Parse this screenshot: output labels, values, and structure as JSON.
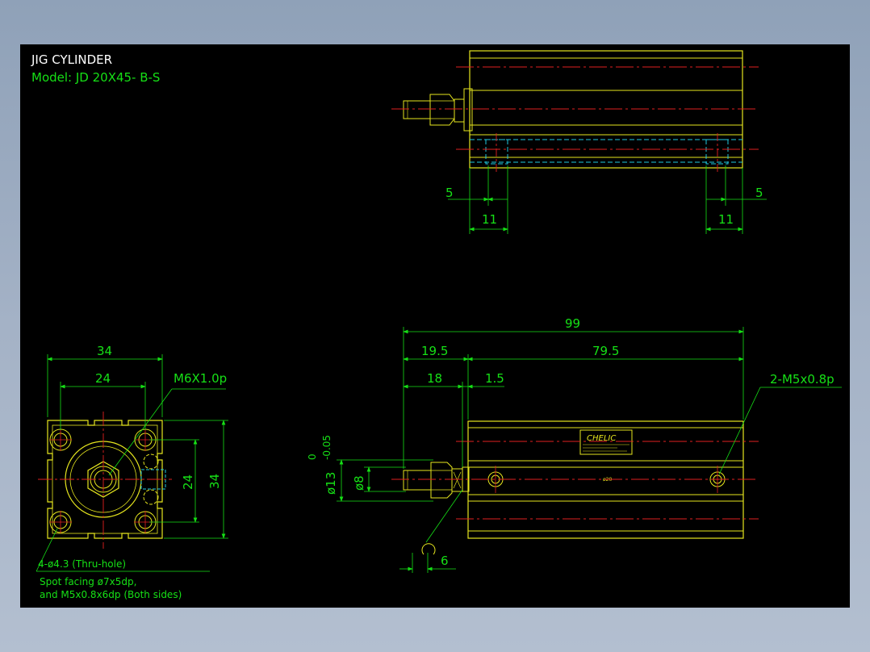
{
  "title": {
    "line1": "JIG CYLINDER",
    "line2": "Model:  JD 20X45- B-S"
  },
  "top_view": {
    "dim_left_5": "5",
    "dim_left_11": "11",
    "dim_right_5": "5",
    "dim_right_11": "11"
  },
  "front_view": {
    "dim_34_width": "34",
    "dim_24_width": "24",
    "dim_24_height": "24",
    "dim_34_height": "34",
    "thread_label": "M6X1.0p",
    "hole_note": "4-ø4.3 (Thru-hole)",
    "spot_note_1": "Spot facing ø7x5dp,",
    "spot_note_2": "and M5x0.8x6dp (Both sides)"
  },
  "side_view": {
    "dim_total": "99",
    "dim_19_5": "19.5",
    "dim_79_5": "79.5",
    "dim_18": "18",
    "dim_1_5": "1.5",
    "port_label": "2-M5x0.8p",
    "dim_dia13": "ø13",
    "tol_upper": "0",
    "tol_lower": "-0.05",
    "dim_dia8": "ø8",
    "dim_6": "6",
    "brand_label": "CHELIC",
    "tiny_mark": "ø20"
  },
  "colors": {
    "background": "#000000",
    "body": "#e6e61e",
    "dimension": "#16e016",
    "centerline": "#e02020",
    "hidden": "#20c8e0",
    "text": "#ffffff"
  }
}
